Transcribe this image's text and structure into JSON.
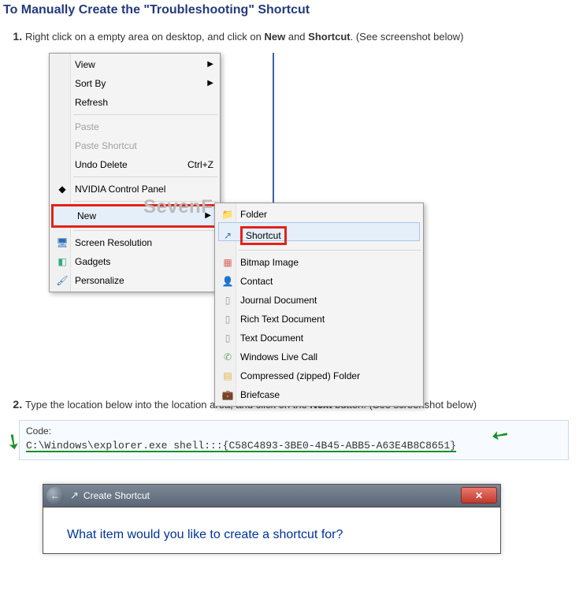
{
  "heading": "To Manually Create the \"Troubleshooting\" Shortcut",
  "step1": {
    "prefix": "Right click on a empty area on desktop, and click on ",
    "bold1": "New",
    "mid": " and ",
    "bold2": "Shortcut",
    "suffix": ". (See screenshot below)"
  },
  "ctx": {
    "view": "View",
    "sortby": "Sort By",
    "refresh": "Refresh",
    "paste": "Paste",
    "paste_sc": "Paste Shortcut",
    "undo": "Undo Delete",
    "undo_sc": "Ctrl+Z",
    "nvidia": "NVIDIA Control Panel",
    "new": "New",
    "screenres": "Screen Resolution",
    "gadgets": "Gadgets",
    "personalize": "Personalize"
  },
  "sub": {
    "folder": "Folder",
    "shortcut": "Shortcut",
    "bitmap": "Bitmap Image",
    "contact": "Contact",
    "journal": "Journal Document",
    "rtf": "Rich Text Document",
    "txt": "Text Document",
    "wlc": "Windows Live Call",
    "zip": "Compressed (zipped) Folder",
    "brief": "Briefcase"
  },
  "watermark": "SevenForums.com",
  "step2": {
    "prefix": "Type the location below into the location area, and click on the ",
    "bold": "Next",
    "suffix": " button. (See screenshot below)"
  },
  "code_label": "Code:",
  "code_value": "C:\\Windows\\explorer.exe shell:::{C58C4893-3BE0-4B45-ABB5-A63E4B8C8651}",
  "wizard": {
    "title": "Create Shortcut",
    "heading": "What item would you like to create a shortcut for?"
  }
}
